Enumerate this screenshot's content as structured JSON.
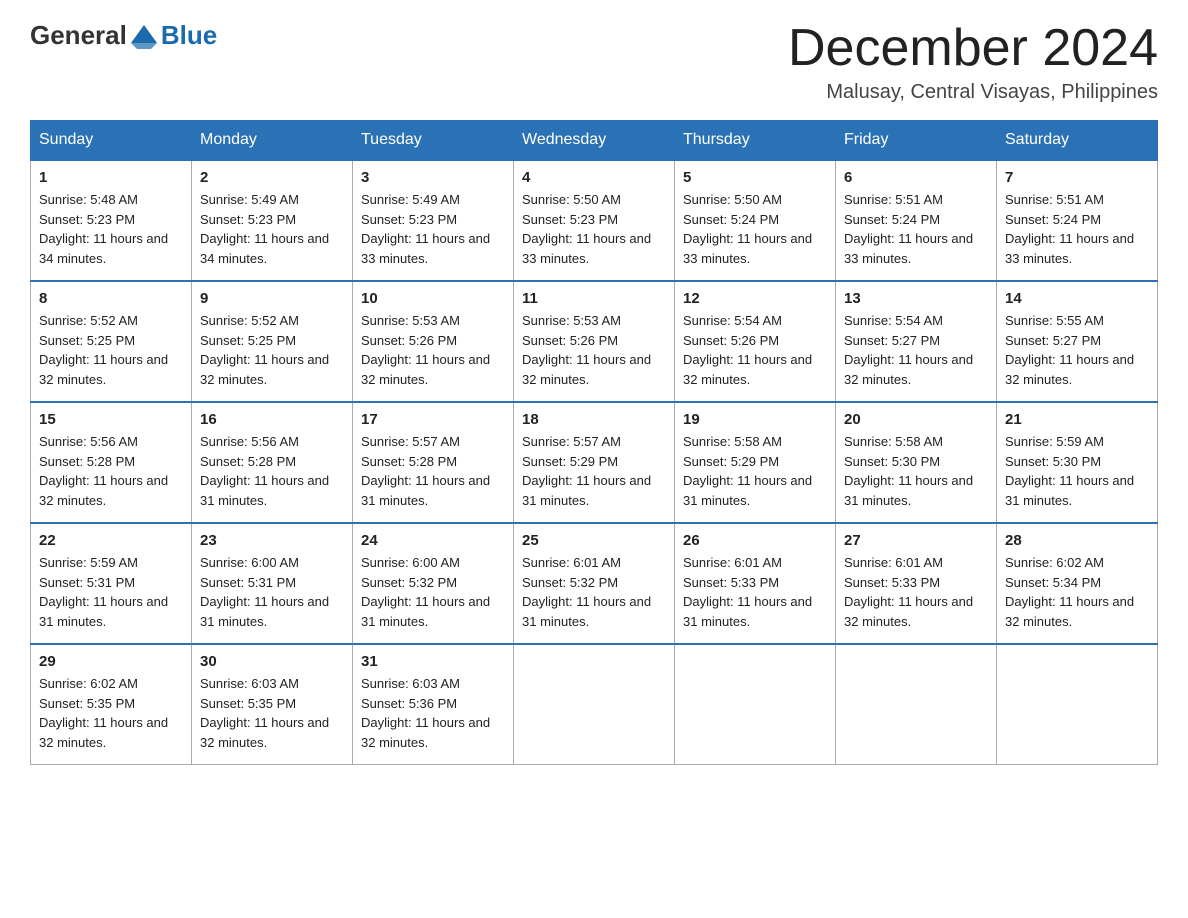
{
  "header": {
    "logo_general": "General",
    "logo_blue": "Blue",
    "month_title": "December 2024",
    "location": "Malusay, Central Visayas, Philippines"
  },
  "weekdays": [
    "Sunday",
    "Monday",
    "Tuesday",
    "Wednesday",
    "Thursday",
    "Friday",
    "Saturday"
  ],
  "weeks": [
    [
      {
        "day": "1",
        "sunrise": "5:48 AM",
        "sunset": "5:23 PM",
        "daylight": "11 hours and 34 minutes."
      },
      {
        "day": "2",
        "sunrise": "5:49 AM",
        "sunset": "5:23 PM",
        "daylight": "11 hours and 34 minutes."
      },
      {
        "day": "3",
        "sunrise": "5:49 AM",
        "sunset": "5:23 PM",
        "daylight": "11 hours and 33 minutes."
      },
      {
        "day": "4",
        "sunrise": "5:50 AM",
        "sunset": "5:23 PM",
        "daylight": "11 hours and 33 minutes."
      },
      {
        "day": "5",
        "sunrise": "5:50 AM",
        "sunset": "5:24 PM",
        "daylight": "11 hours and 33 minutes."
      },
      {
        "day": "6",
        "sunrise": "5:51 AM",
        "sunset": "5:24 PM",
        "daylight": "11 hours and 33 minutes."
      },
      {
        "day": "7",
        "sunrise": "5:51 AM",
        "sunset": "5:24 PM",
        "daylight": "11 hours and 33 minutes."
      }
    ],
    [
      {
        "day": "8",
        "sunrise": "5:52 AM",
        "sunset": "5:25 PM",
        "daylight": "11 hours and 32 minutes."
      },
      {
        "day": "9",
        "sunrise": "5:52 AM",
        "sunset": "5:25 PM",
        "daylight": "11 hours and 32 minutes."
      },
      {
        "day": "10",
        "sunrise": "5:53 AM",
        "sunset": "5:26 PM",
        "daylight": "11 hours and 32 minutes."
      },
      {
        "day": "11",
        "sunrise": "5:53 AM",
        "sunset": "5:26 PM",
        "daylight": "11 hours and 32 minutes."
      },
      {
        "day": "12",
        "sunrise": "5:54 AM",
        "sunset": "5:26 PM",
        "daylight": "11 hours and 32 minutes."
      },
      {
        "day": "13",
        "sunrise": "5:54 AM",
        "sunset": "5:27 PM",
        "daylight": "11 hours and 32 minutes."
      },
      {
        "day": "14",
        "sunrise": "5:55 AM",
        "sunset": "5:27 PM",
        "daylight": "11 hours and 32 minutes."
      }
    ],
    [
      {
        "day": "15",
        "sunrise": "5:56 AM",
        "sunset": "5:28 PM",
        "daylight": "11 hours and 32 minutes."
      },
      {
        "day": "16",
        "sunrise": "5:56 AM",
        "sunset": "5:28 PM",
        "daylight": "11 hours and 31 minutes."
      },
      {
        "day": "17",
        "sunrise": "5:57 AM",
        "sunset": "5:28 PM",
        "daylight": "11 hours and 31 minutes."
      },
      {
        "day": "18",
        "sunrise": "5:57 AM",
        "sunset": "5:29 PM",
        "daylight": "11 hours and 31 minutes."
      },
      {
        "day": "19",
        "sunrise": "5:58 AM",
        "sunset": "5:29 PM",
        "daylight": "11 hours and 31 minutes."
      },
      {
        "day": "20",
        "sunrise": "5:58 AM",
        "sunset": "5:30 PM",
        "daylight": "11 hours and 31 minutes."
      },
      {
        "day": "21",
        "sunrise": "5:59 AM",
        "sunset": "5:30 PM",
        "daylight": "11 hours and 31 minutes."
      }
    ],
    [
      {
        "day": "22",
        "sunrise": "5:59 AM",
        "sunset": "5:31 PM",
        "daylight": "11 hours and 31 minutes."
      },
      {
        "day": "23",
        "sunrise": "6:00 AM",
        "sunset": "5:31 PM",
        "daylight": "11 hours and 31 minutes."
      },
      {
        "day": "24",
        "sunrise": "6:00 AM",
        "sunset": "5:32 PM",
        "daylight": "11 hours and 31 minutes."
      },
      {
        "day": "25",
        "sunrise": "6:01 AM",
        "sunset": "5:32 PM",
        "daylight": "11 hours and 31 minutes."
      },
      {
        "day": "26",
        "sunrise": "6:01 AM",
        "sunset": "5:33 PM",
        "daylight": "11 hours and 31 minutes."
      },
      {
        "day": "27",
        "sunrise": "6:01 AM",
        "sunset": "5:33 PM",
        "daylight": "11 hours and 32 minutes."
      },
      {
        "day": "28",
        "sunrise": "6:02 AM",
        "sunset": "5:34 PM",
        "daylight": "11 hours and 32 minutes."
      }
    ],
    [
      {
        "day": "29",
        "sunrise": "6:02 AM",
        "sunset": "5:35 PM",
        "daylight": "11 hours and 32 minutes."
      },
      {
        "day": "30",
        "sunrise": "6:03 AM",
        "sunset": "5:35 PM",
        "daylight": "11 hours and 32 minutes."
      },
      {
        "day": "31",
        "sunrise": "6:03 AM",
        "sunset": "5:36 PM",
        "daylight": "11 hours and 32 minutes."
      },
      null,
      null,
      null,
      null
    ]
  ],
  "labels": {
    "sunrise": "Sunrise:",
    "sunset": "Sunset:",
    "daylight": "Daylight:"
  }
}
